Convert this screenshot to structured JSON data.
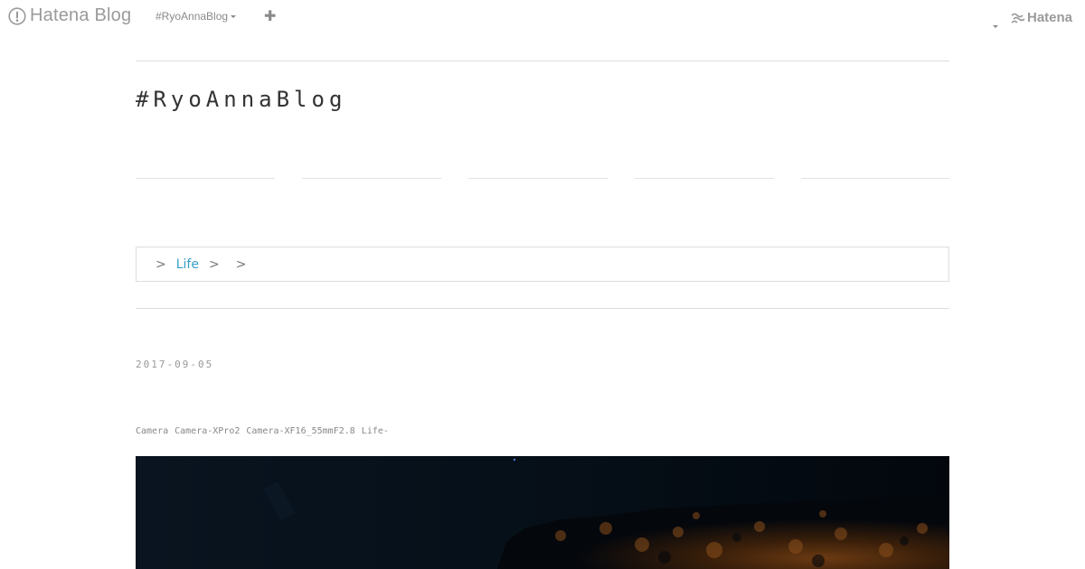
{
  "topbar": {
    "brand_label": "Hatena Blog",
    "blog_switcher_label": "#RyoAnnaBlog",
    "add_button_glyph": "✚",
    "hatena_label": "Hatena"
  },
  "blog": {
    "title": "#RyoAnnaBlog"
  },
  "breadcrumb": {
    "separator": ">",
    "category_label": "Life"
  },
  "entry": {
    "date": "2017-09-05",
    "categories": [
      "Camera",
      "Camera-XPro2",
      "Camera-XF16_55mmF2.8",
      "Life-"
    ],
    "photo_icon": "photo-icon"
  },
  "colors": {
    "link_accent": "#3b9dc7",
    "muted_text": "#999999",
    "rule": "#dddddd"
  }
}
